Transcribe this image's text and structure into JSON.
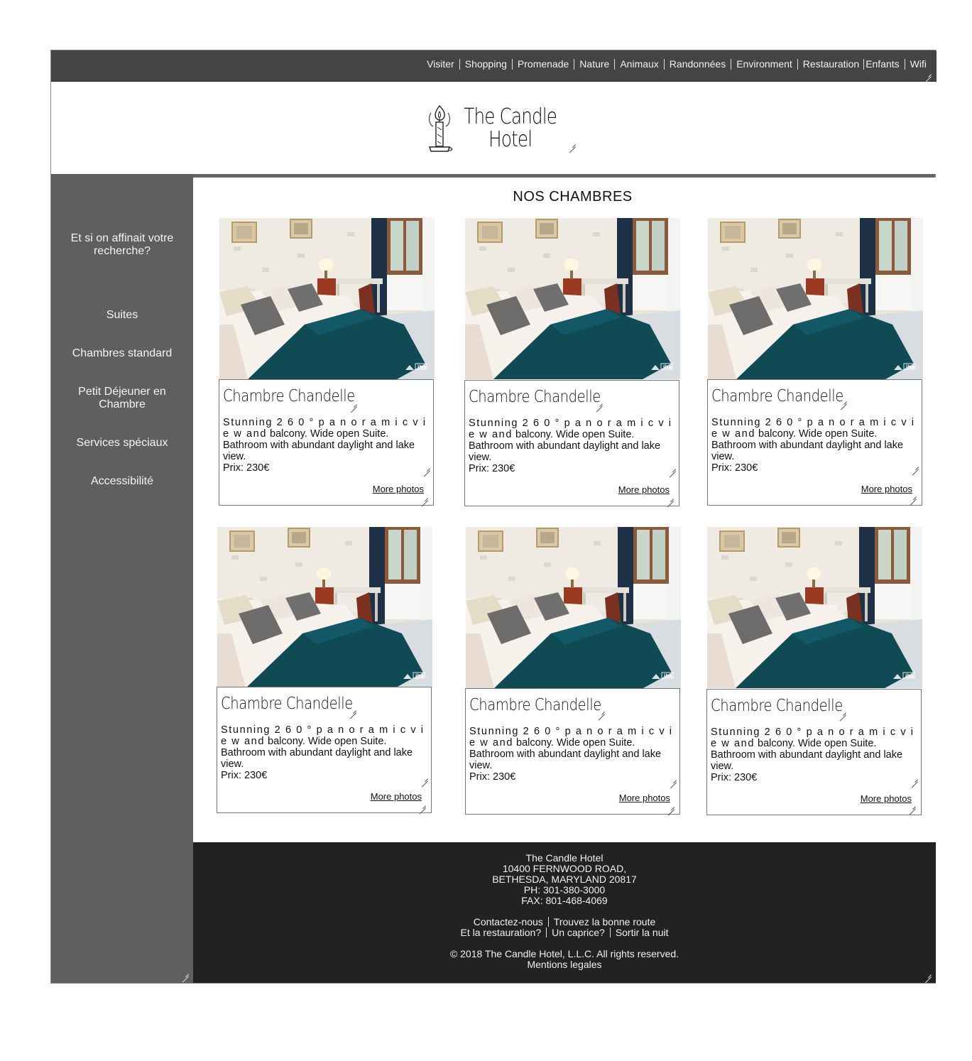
{
  "nav": {
    "items": [
      "Visiter",
      "Shopping",
      "Promenade",
      "Nature",
      "Animaux",
      "Randonnées",
      "Environment",
      "Restauration",
      "Enfants",
      "Wifi"
    ]
  },
  "header": {
    "logo_line1": "The Candle",
    "logo_line2": "Hotel",
    "logo_icon": "candle-icon"
  },
  "sidebar": {
    "intro": "Et si on affinait votre recherche?",
    "items": [
      {
        "label": "Suites"
      },
      {
        "label": "Chambres standard"
      },
      {
        "label": "Petit Déjeuner en Chambre"
      },
      {
        "label": "Services spéciaux"
      },
      {
        "label": "Accessibilité"
      }
    ]
  },
  "main": {
    "title": "NOS CHAMBRES",
    "rooms": [
      {
        "title": "Chambre Chandelle",
        "desc_spaced": "Stunning 2 6 0 ° p a n o r a m i c v i e w and",
        "desc_rest": "balcony. Wide open Suite. Bathroom with abundant daylight and lake view.",
        "price": "Prix: 230€",
        "more": "More photos"
      },
      {
        "title": "Chambre Chandelle",
        "desc_spaced": "Stunning 2 6 0 ° p a n o r a m i c v i e w and",
        "desc_rest": "balcony. Wide open Suite. Bathroom with abundant daylight and lake view.",
        "price": "Prix: 230€",
        "more": "More photos"
      },
      {
        "title": "Chambre Chandelle",
        "desc_spaced": "Stunning 2 6 0 ° p a n o r a m i c v i e w and",
        "desc_rest": "balcony. Wide open Suite. Bathroom with abundant daylight and lake view.",
        "price": "Prix: 230€",
        "more": "More photos"
      },
      {
        "title": "Chambre Chandelle",
        "desc_spaced": "Stunning 2 6 0 ° p a n o r a m i c v i e w and",
        "desc_rest": "balcony. Wide open Suite. Bathroom with abundant daylight and lake view.",
        "price": "Prix: 230€",
        "more": "More photos"
      },
      {
        "title": "Chambre Chandelle",
        "desc_spaced": "Stunning 2 6 0 ° p a n o r a m i c v i e w and",
        "desc_rest": "balcony. Wide open Suite. Bathroom with abundant daylight and lake view.",
        "price": "Prix: 230€",
        "more": "More photos"
      },
      {
        "title": "Chambre Chandelle",
        "desc_spaced": "Stunning 2 6 0 ° p a n o r a m i c v i e w and",
        "desc_rest": "balcony. Wide open Suite. Bathroom with abundant daylight and lake view.",
        "price": "Prix: 230€",
        "more": "More photos"
      }
    ],
    "photo_watermark": "iha"
  },
  "footer": {
    "name": "The Candle Hotel",
    "address1": "10400 FERNWOOD ROAD,",
    "address2": "BETHESDA, MARYLAND 20817",
    "phone": "PH: 301-380-3000",
    "fax": "FAX: 801-468-4069",
    "links_row1": [
      "Contactez-nous",
      "Trouvez la bonne route"
    ],
    "links_row2": [
      "Et la restauration?",
      "Un caprice?",
      "Sortir la nuit"
    ],
    "copyright": "© 2018 The Candle Hotel, L.L.C. All rights reserved.",
    "legal": "Mentions legales"
  },
  "colors": {
    "nav_bg": "#444444",
    "sidebar_bg": "#5f5f5f",
    "footer_bg": "#222222",
    "bedspread": "#0f4a55"
  }
}
